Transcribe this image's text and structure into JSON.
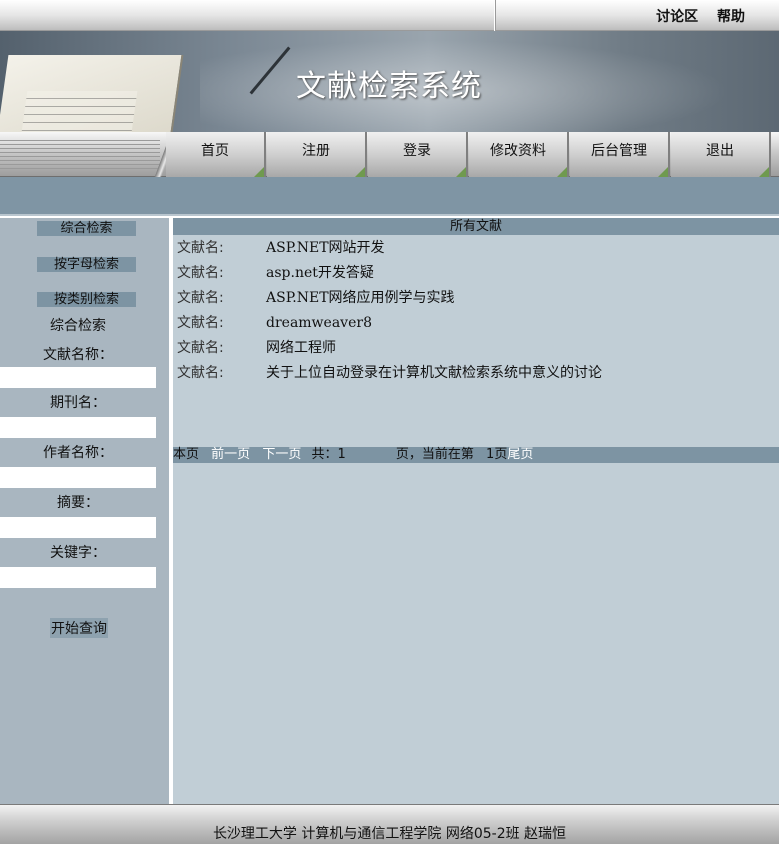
{
  "top_links": {
    "forum": "讨论区",
    "help": "帮助"
  },
  "banner": {
    "title": "文献检索系统"
  },
  "nav": [
    {
      "label": "首页"
    },
    {
      "label": "注册"
    },
    {
      "label": "登录"
    },
    {
      "label": "修改资料"
    },
    {
      "label": "后台管理"
    },
    {
      "label": "退出"
    }
  ],
  "sidebar": {
    "buttons": [
      "综合检索",
      "按字母检索",
      "按类别检索"
    ],
    "section_title": "综合检索",
    "fields": [
      {
        "label": "文献名称：",
        "value": ""
      },
      {
        "label": "期刊名：",
        "value": ""
      },
      {
        "label": "作者名称：",
        "value": ""
      },
      {
        "label": "摘要：",
        "value": ""
      },
      {
        "label": "关键字：",
        "value": ""
      }
    ],
    "search_button": "开始查询"
  },
  "main": {
    "header": "所有文献",
    "row_label": "文献名:",
    "rows": [
      "ASP.NET网站开发",
      "asp.net开发答疑",
      "ASP.NET网络应用例学与实践",
      "dreamweaver8",
      "网络工程师",
      "关于上位自动登录在计算机文献检索系统中意义的讨论"
    ]
  },
  "pager": {
    "first": "本页",
    "prev": "前一页",
    "next": "下一页",
    "total_prefix": "共：1",
    "pages_text": "页，当前在第",
    "current": "1页",
    "last": "尾页"
  },
  "footer": {
    "text": "长沙理工大学  计算机与通信工程学院  网络05-2班  赵瑞恒"
  },
  "colors": {
    "band": "#7f95a4",
    "sidebar": "#a9b6c0",
    "main_bg": "#c1ced6",
    "header_bar": "#7d94a3"
  }
}
